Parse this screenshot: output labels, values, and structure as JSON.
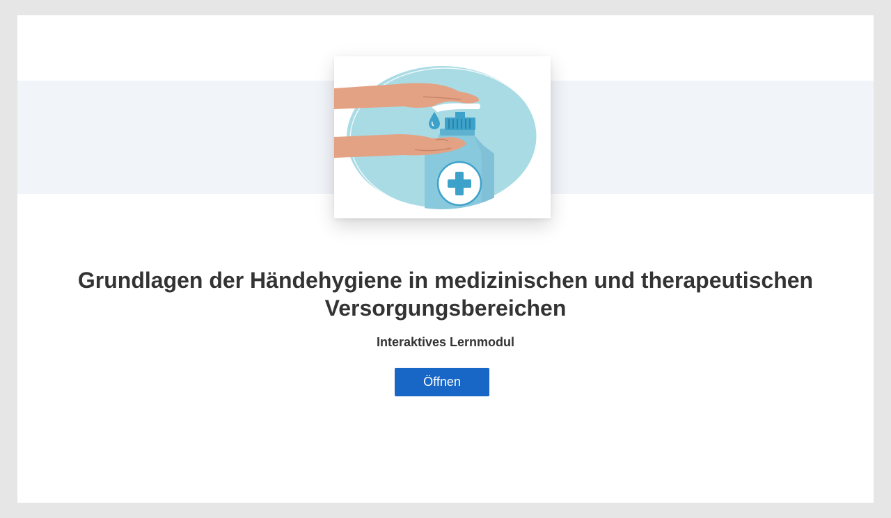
{
  "course": {
    "title": "Grundlagen der Händehygiene in medizinischen und therapeutischen Versorgungsbereichen",
    "subtitle": "Interaktives Lernmodul",
    "open_label": "Öffnen"
  },
  "illustration": {
    "icon": "hand-sanitizer-illustration",
    "colors": {
      "circle": "#a9dbe5",
      "skin": "#e4a284",
      "bottle": "#89c9dd",
      "pump": "#3da2c9",
      "cross": "#3da2c9"
    }
  },
  "colors": {
    "page_background": "#e6e6e6",
    "band": "#f1f4f9",
    "button": "#1866c6",
    "text": "#333333"
  }
}
